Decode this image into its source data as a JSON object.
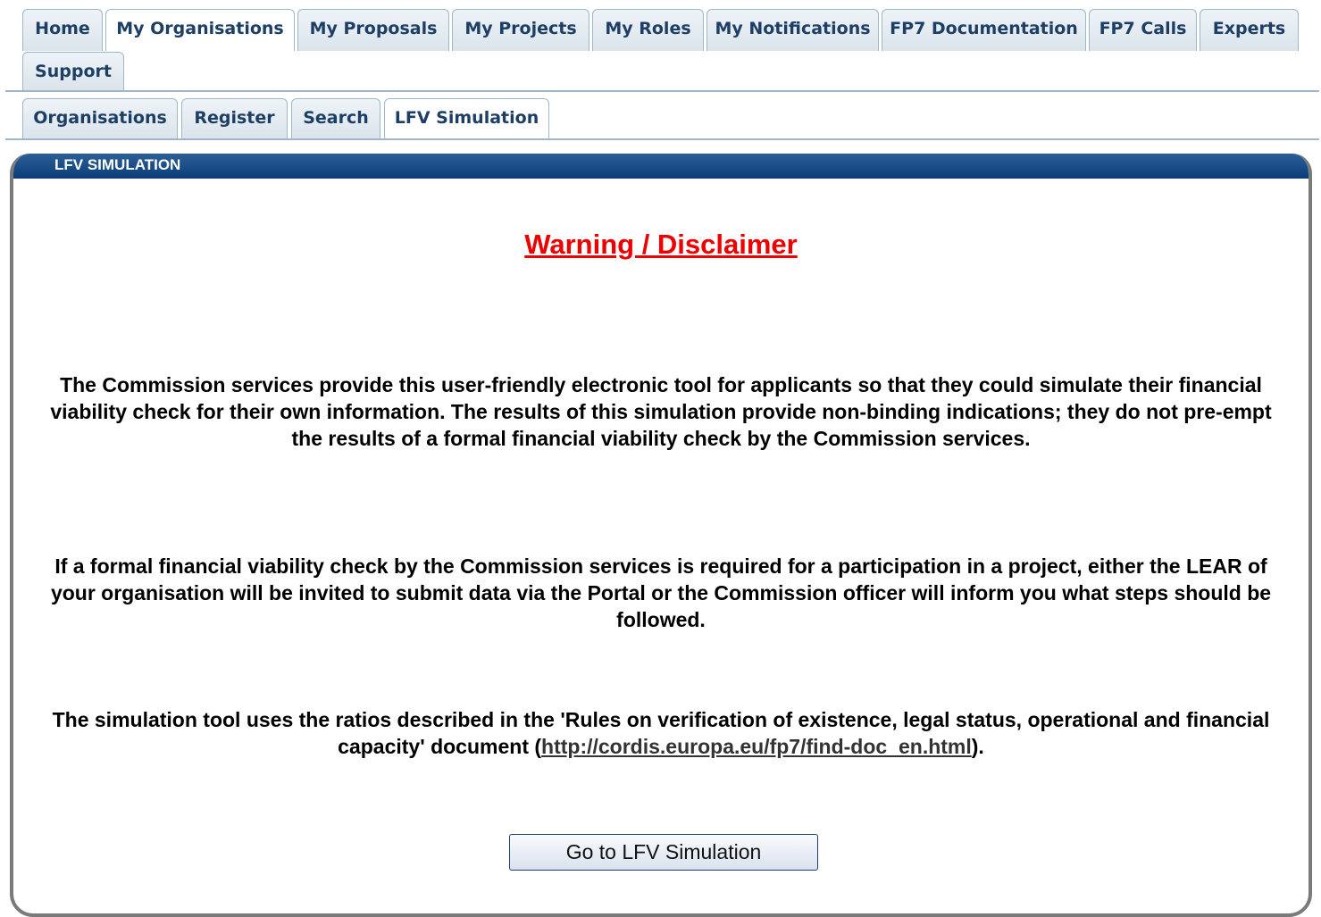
{
  "main_tabs": [
    {
      "label": "Home",
      "active": false
    },
    {
      "label": "My Organisations",
      "active": true
    },
    {
      "label": "My Proposals",
      "active": false
    },
    {
      "label": "My Projects",
      "active": false
    },
    {
      "label": "My Roles",
      "active": false
    },
    {
      "label": "My Notifications",
      "active": false
    },
    {
      "label": "FP7 Documentation",
      "active": false
    },
    {
      "label": "FP7 Calls",
      "active": false
    },
    {
      "label": "Experts",
      "active": false
    },
    {
      "label": "Support",
      "active": false
    }
  ],
  "sub_tabs": [
    {
      "label": "Organisations",
      "active": false
    },
    {
      "label": "Register",
      "active": false
    },
    {
      "label": "Search",
      "active": false
    },
    {
      "label": "LFV Simulation",
      "active": true
    }
  ],
  "panel": {
    "title": "LFV SIMULATION",
    "heading": "Warning / Disclaimer",
    "paragraph_1": "The Commission services provide this user-friendly electronic tool for applicants so that they could simulate their financial viability check for their own information. The results of this simulation provide non-binding indications; they do not pre-empt the results of a formal financial viability check by the Commission services.",
    "paragraph_2": "If a formal financial viability check by the Commission services is required for a participation in a project, either the LEAR of your organisation will be invited to submit data via the Portal or the Commission officer will inform you what steps should be followed.",
    "paragraph_3_before": "The simulation tool uses the ratios described in the 'Rules on verification of existence, legal status, operational and financial capacity' document (",
    "paragraph_3_link": "http://cordis.europa.eu/fp7/find-doc_en.html",
    "paragraph_3_after": ").",
    "button_label": "Go to LFV Simulation"
  },
  "colors": {
    "tab_border": "#9fb7c9",
    "tab_text": "#1d3f66",
    "header_blue": "#0a3d78",
    "heading_red": "#ee0000"
  }
}
